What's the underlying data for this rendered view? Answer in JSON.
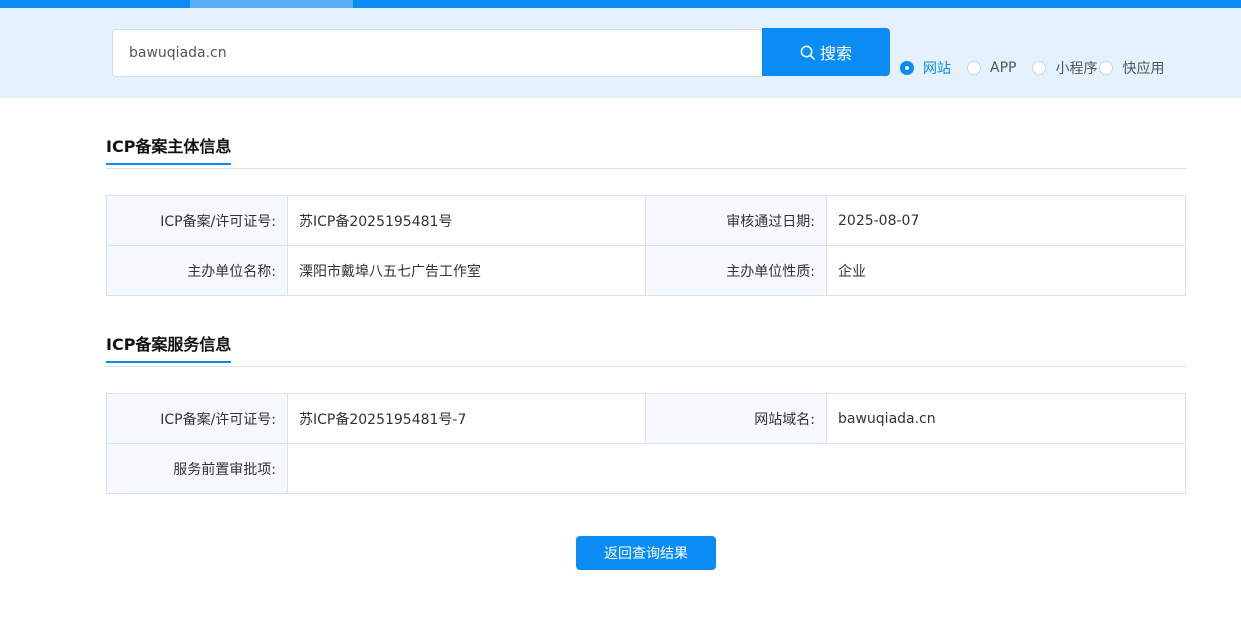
{
  "search": {
    "value": "bawuqiada.cn",
    "button_label": "搜索",
    "types": [
      {
        "label": "网站",
        "checked": true
      },
      {
        "label": "APP",
        "checked": false
      },
      {
        "label": "小程序",
        "checked": false
      },
      {
        "label": "快应用",
        "checked": false
      }
    ]
  },
  "entity": {
    "title": "ICP备案主体信息",
    "license_label": "ICP备案/许可证号:",
    "license_value": "苏ICP备2025195481号",
    "approved_label": "审核通过日期:",
    "approved_value": "2025-08-07",
    "org_name_label": "主办单位名称:",
    "org_name_value": "溧阳市戴埠八五七广告工作室",
    "org_type_label": "主办单位性质:",
    "org_type_value": "企业"
  },
  "service": {
    "title": "ICP备案服务信息",
    "license_label": "ICP备案/许可证号:",
    "license_value": "苏ICP备2025195481号-7",
    "domain_label": "网站域名:",
    "domain_value": "bawuqiada.cn",
    "preapproval_label": "服务前置审批项:",
    "preapproval_value": ""
  },
  "back_button_label": "返回查询结果",
  "colors": {
    "accent": "#0b8cf4",
    "band": "#e3f2fe"
  }
}
